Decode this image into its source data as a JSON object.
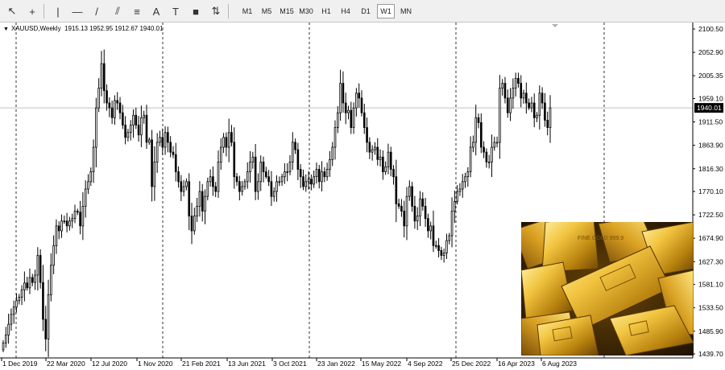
{
  "toolbar": {
    "tools": [
      {
        "name": "cursor-icon",
        "glyph": "↖"
      },
      {
        "name": "crosshair-icon",
        "glyph": "+"
      },
      {
        "name": "vertical-line-icon",
        "glyph": "|"
      },
      {
        "name": "horizontal-line-icon",
        "glyph": "—"
      },
      {
        "name": "trendline-icon",
        "glyph": "/"
      },
      {
        "name": "channel-icon",
        "glyph": "⫽"
      },
      {
        "name": "fibonacci-icon",
        "glyph": "≡"
      },
      {
        "name": "text-icon",
        "glyph": "A"
      },
      {
        "name": "text-label-icon",
        "glyph": "T"
      },
      {
        "name": "rectangle-icon",
        "glyph": "■"
      },
      {
        "name": "arrows-icon",
        "glyph": "⇅"
      }
    ],
    "timeframes": [
      "M1",
      "M5",
      "M15",
      "M30",
      "H1",
      "H4",
      "D1",
      "W1",
      "MN"
    ],
    "active_timeframe": "W1"
  },
  "symbol": {
    "name": "XAUUSD,Weekly",
    "ohlc": "1915.13 1952.95 1912.67 1940.01"
  },
  "price_axis": {
    "labels": [
      "2100.50",
      "2052.90",
      "2005.35",
      "1959.10",
      "1911.50",
      "1863.90",
      "1816.30",
      "1770.10",
      "1722.50",
      "1674.90",
      "1627.30",
      "1581.10",
      "1533.50",
      "1485.90",
      "1439.70"
    ],
    "current_price": "1940.01"
  },
  "time_axis": {
    "labels": [
      "1 Dec 2019",
      "22 Mar 2020",
      "12 Jul 2020",
      "1 Nov 2020",
      "21 Feb 2021",
      "13 Jun 2021",
      "3 Oct 2021",
      "23 Jan 2022",
      "15 May 2022",
      "4 Sep 2022",
      "25 Dec 2022",
      "16 Apr 2023",
      "6 Aug 2023"
    ]
  },
  "colors": {
    "candle_up": "#ffffff",
    "candle_down": "#000000",
    "candle_border": "#000000",
    "grid_separator": "#000000",
    "price_line": "#c0c0c0",
    "current_price_bg": "#000000",
    "current_price_text": "#ffffff"
  },
  "chart_data": {
    "type": "candlestick",
    "timeframe": "weekly",
    "y_range": [
      1439.7,
      2100.5
    ],
    "close_series": [
      1462,
      1478,
      1500,
      1520,
      1535,
      1548,
      1555,
      1570,
      1584,
      1574,
      1595,
      1585,
      1600,
      1640,
      1585,
      1510,
      1470,
      1560,
      1620,
      1660,
      1700,
      1690,
      1710,
      1710,
      1700,
      1710,
      1715,
      1730,
      1728,
      1700,
      1740,
      1775,
      1790,
      1810,
      1860,
      1940,
      1980,
      2030,
      1975,
      1950,
      1940,
      1920,
      1955,
      1950,
      1930,
      1905,
      1880,
      1890,
      1905,
      1925,
      1905,
      1885,
      1920,
      1925,
      1870,
      1875,
      1780,
      1830,
      1870,
      1880,
      1860,
      1890,
      1870,
      1850,
      1845,
      1810,
      1790,
      1770,
      1780,
      1790,
      1720,
      1690,
      1720,
      1740,
      1770,
      1730,
      1760,
      1790,
      1800,
      1780,
      1770,
      1830,
      1860,
      1880,
      1860,
      1890,
      1870,
      1800,
      1790,
      1770,
      1780,
      1790,
      1810,
      1830,
      1840,
      1770,
      1790,
      1830,
      1810,
      1800,
      1790,
      1760,
      1770,
      1790,
      1790,
      1800,
      1810,
      1810,
      1830,
      1870,
      1855,
      1815,
      1800,
      1780,
      1790,
      1795,
      1785,
      1800,
      1815,
      1790,
      1810,
      1800,
      1815,
      1835,
      1860,
      1900,
      1930,
      1990,
      1950,
      1930,
      1935,
      1900,
      1940,
      1970,
      1960,
      1930,
      1900,
      1870,
      1850,
      1855,
      1860,
      1835,
      1840,
      1810,
      1820,
      1850,
      1815,
      1800,
      1745,
      1740,
      1730,
      1700,
      1760,
      1780,
      1740,
      1710,
      1720,
      1755,
      1740,
      1715,
      1690,
      1700,
      1660,
      1660,
      1650,
      1640,
      1645,
      1670,
      1680,
      1730,
      1750,
      1770,
      1775,
      1790,
      1800,
      1810,
      1860,
      1870,
      1920,
      1910,
      1860,
      1850,
      1830,
      1830,
      1860,
      1870,
      1870,
      1980,
      1990,
      1960,
      1930,
      1960,
      1980,
      2000,
      1990,
      1960,
      1970,
      1950,
      1940,
      1950,
      1920,
      1925,
      1970,
      1950,
      1915,
      1900,
      1940
    ]
  },
  "photo": {
    "subject": "gold bullion bars",
    "bar_text": "FINE GOLD 999.9"
  }
}
